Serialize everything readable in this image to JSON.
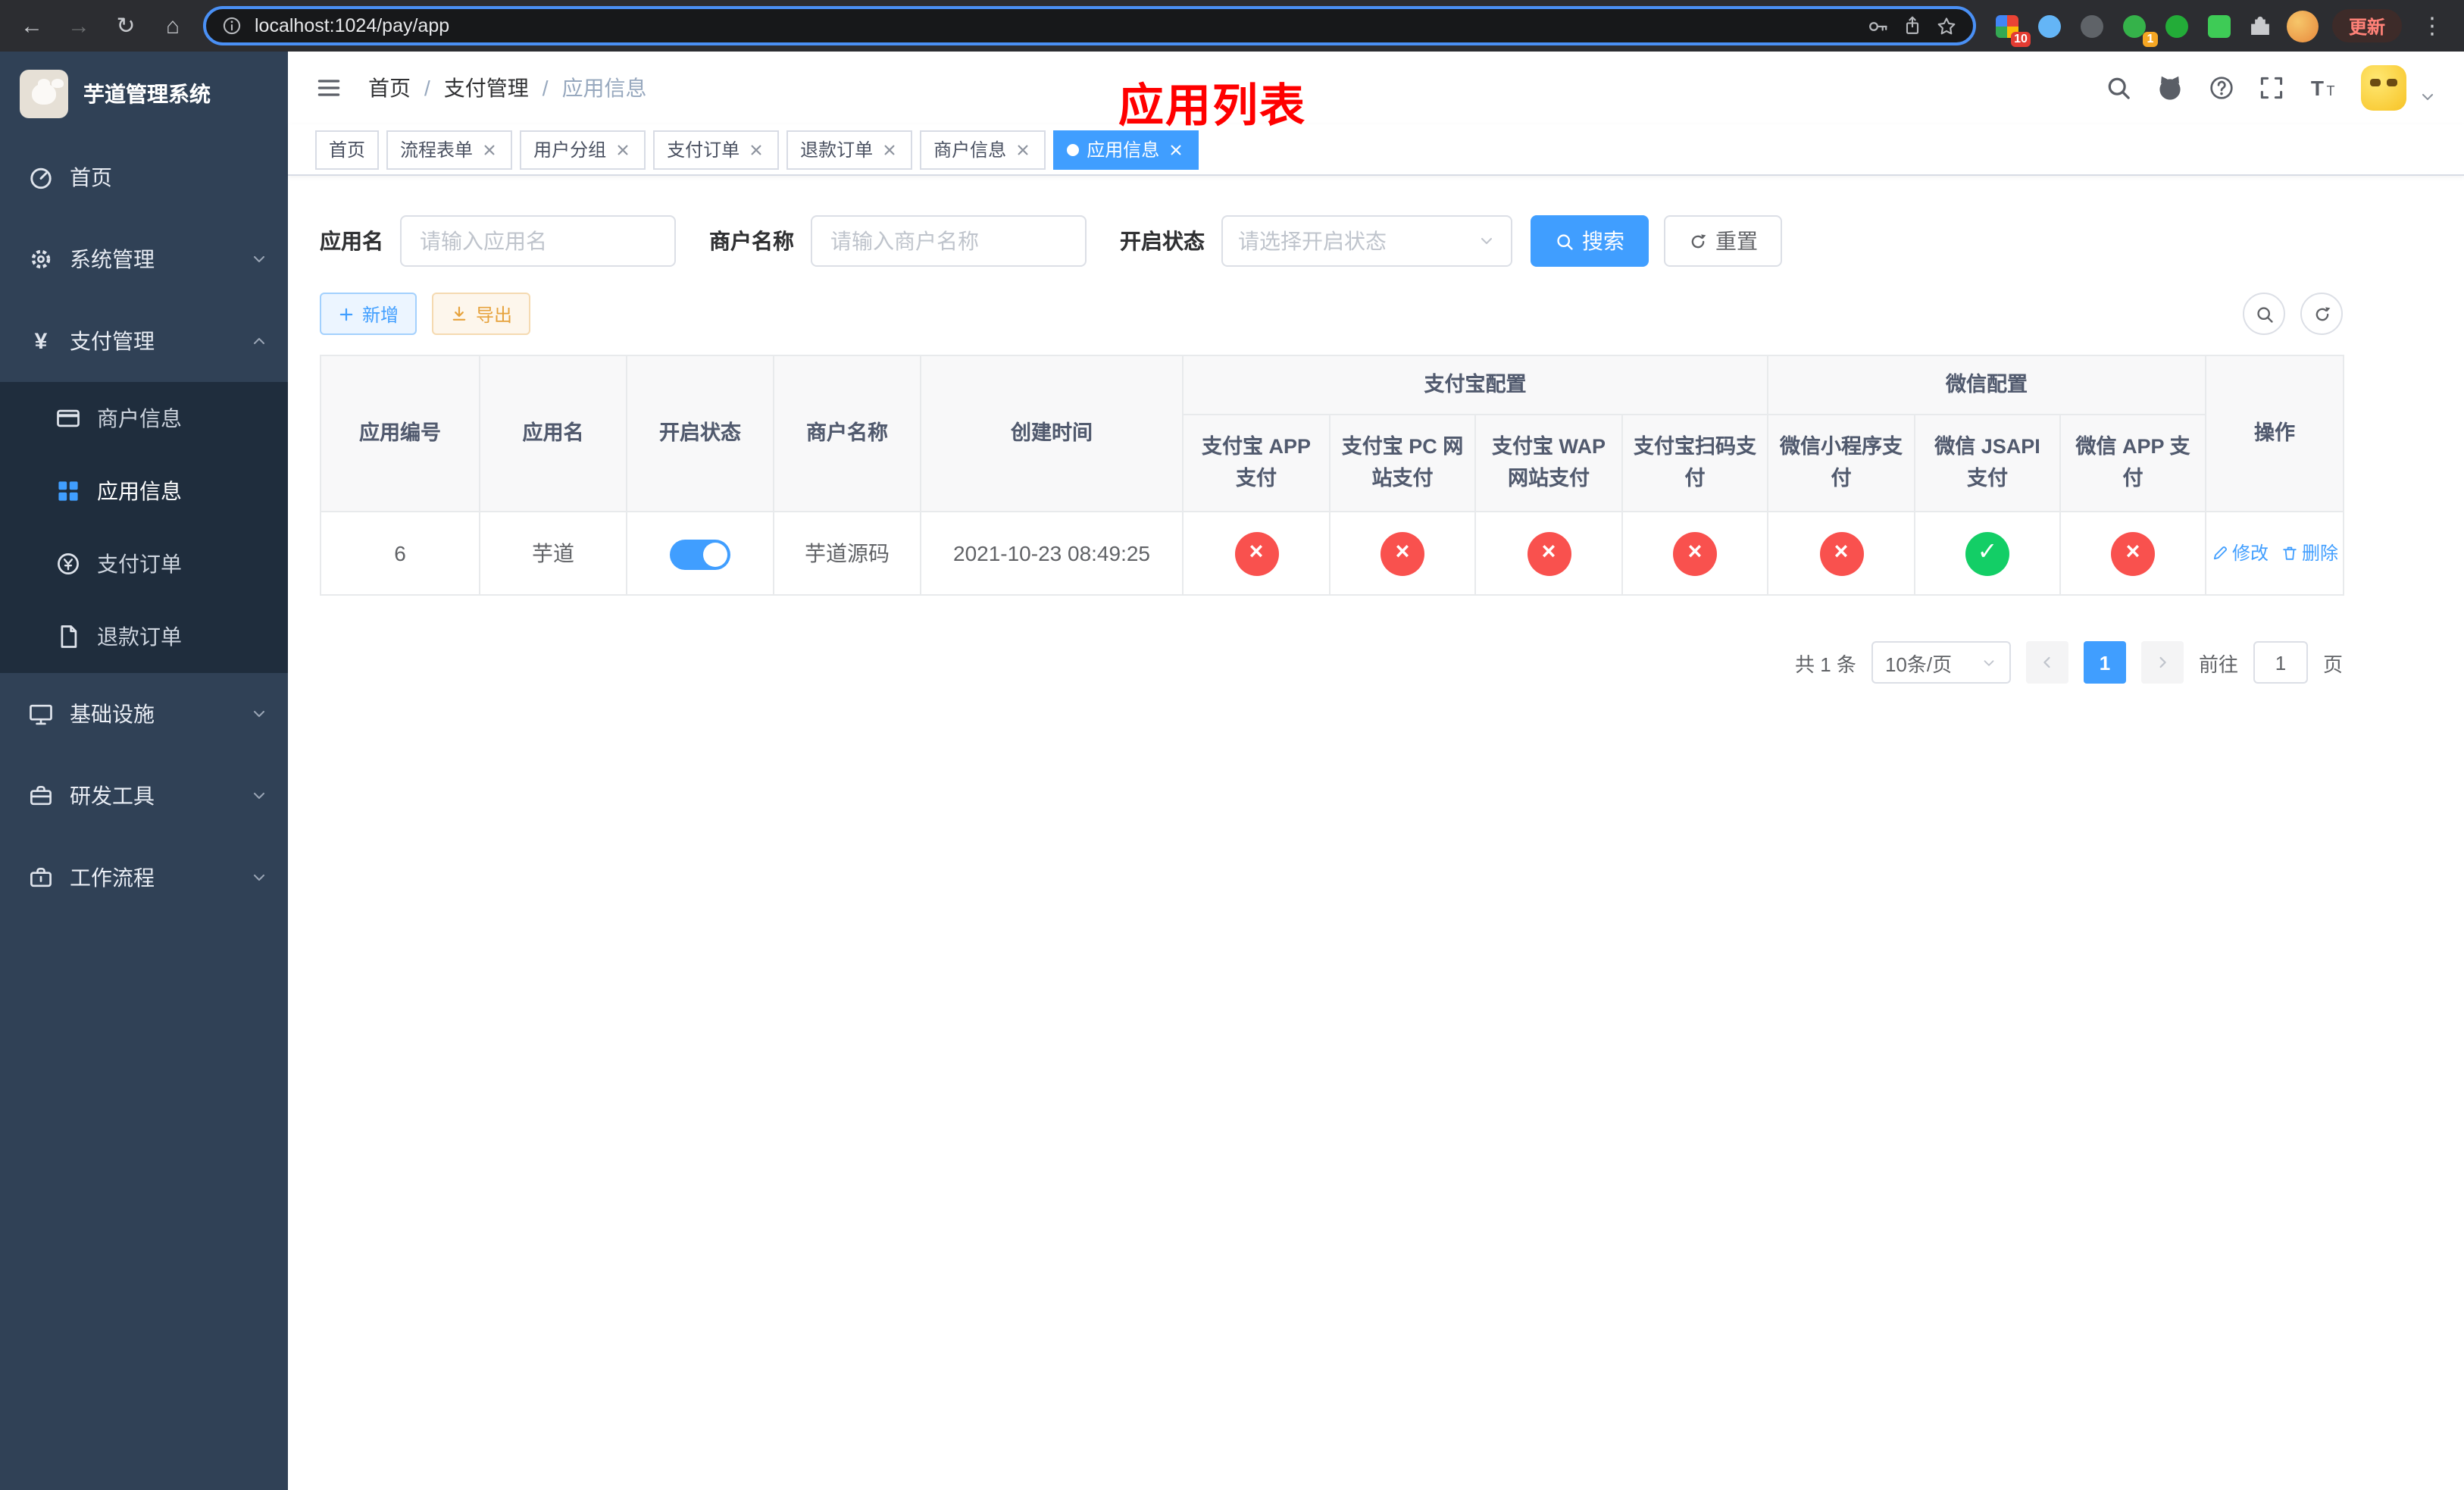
{
  "browser": {
    "url": "localhost:1024/pay/app",
    "update_button": "更新",
    "ext_badge_colorful": "10",
    "ext_badge_green": "1"
  },
  "icons": {
    "back": "←",
    "forward": "→",
    "reload": "↻",
    "home": "⌂",
    "kebab": "⋮",
    "yen": "¥",
    "check": "✓",
    "cross": "×"
  },
  "colors": {
    "primary": "#409EFF",
    "danger": "#f9514e",
    "success": "#13ce66",
    "annotation": "#ff0000",
    "sidebar_bg": "#304156",
    "submenu_bg": "#1f2d3d"
  },
  "sidebar": {
    "title": "芋道管理系统",
    "menu_home": "首页",
    "menu_system": "系统管理",
    "menu_pay": "支付管理",
    "menu_infra": "基础设施",
    "menu_dev": "研发工具",
    "menu_flow": "工作流程",
    "sub_merchant": "商户信息",
    "sub_app": "应用信息",
    "sub_order": "支付订单",
    "sub_refund": "退款订单"
  },
  "header": {
    "breadcrumb": [
      "首页",
      "支付管理",
      "应用信息"
    ],
    "separator": "/",
    "annotation": "应用列表"
  },
  "tags": [
    {
      "label": "首页"
    },
    {
      "label": "流程表单"
    },
    {
      "label": "用户分组"
    },
    {
      "label": "支付订单"
    },
    {
      "label": "退款订单"
    },
    {
      "label": "商户信息"
    },
    {
      "label": "应用信息"
    }
  ],
  "filters": {
    "app_name_label": "应用名",
    "app_name_placeholder": "请输入应用名",
    "merchant_label": "商户名称",
    "merchant_placeholder": "请输入商户名称",
    "status_label": "开启状态",
    "status_placeholder": "请选择开启状态",
    "search_button": "搜索",
    "reset_button": "重置"
  },
  "toolbar": {
    "add_button": "新增",
    "export_button": "导出"
  },
  "table": {
    "headers": {
      "app_id": "应用编号",
      "app_name": "应用名",
      "status": "开启状态",
      "merchant": "商户名称",
      "created": "创建时间",
      "alipay_group": "支付宝配置",
      "wechat_group": "微信配置",
      "alipay_app": "支付宝 APP 支付",
      "alipay_pc": "支付宝 PC 网站支付",
      "alipay_wap": "支付宝 WAP 网站支付",
      "alipay_qr": "支付宝扫码支付",
      "wx_mini": "微信小程序支付",
      "wx_jsapi": "微信 JSAPI 支付",
      "wx_app": "微信 APP 支付",
      "actions": "操作"
    },
    "rows": [
      {
        "app_id": "6",
        "app_name": "芋道",
        "status_on": true,
        "merchant": "芋道源码",
        "created": "2021-10-23 08:49:25",
        "alipay_app": "×",
        "alipay_pc": "×",
        "alipay_wap": "×",
        "alipay_qr": "×",
        "wx_mini": "×",
        "wx_jsapi": "✓",
        "wx_app": "×",
        "edit": "修改",
        "delete": "删除"
      }
    ]
  },
  "pagination": {
    "total": "共 1 条",
    "page_size": "10条/页",
    "page": "1",
    "goto_prefix": "前往",
    "goto_value": "1",
    "goto_suffix": "页"
  }
}
